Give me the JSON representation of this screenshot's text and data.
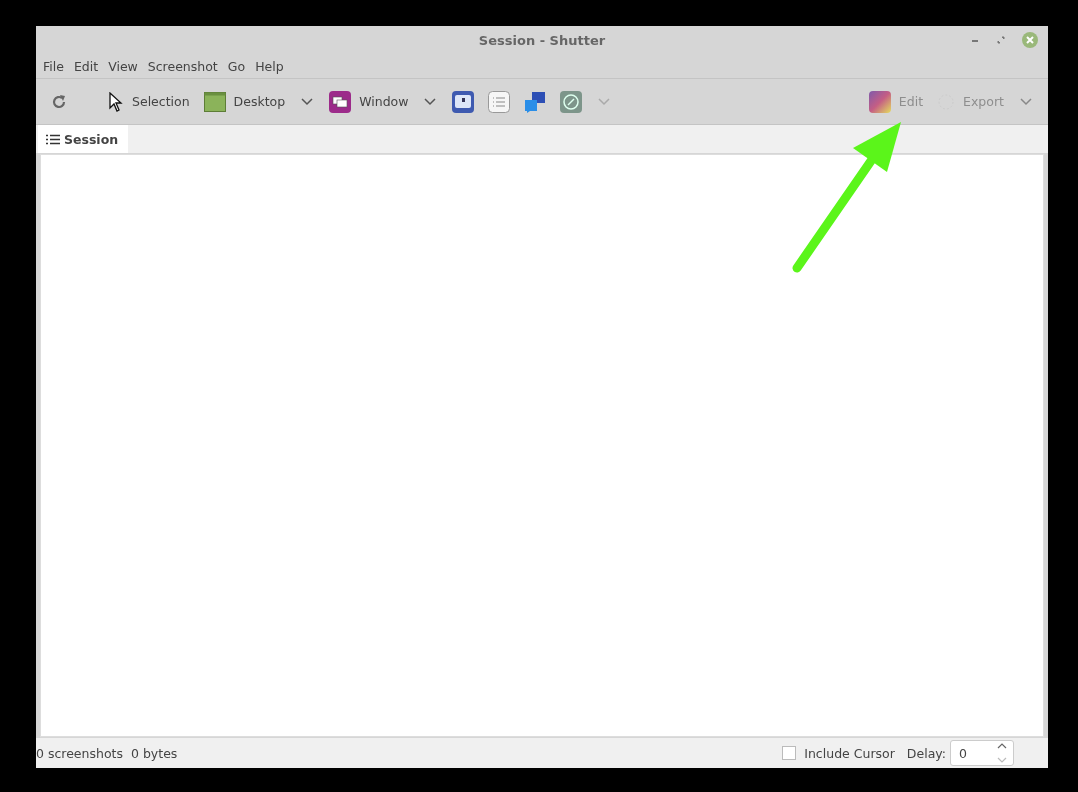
{
  "window": {
    "title": "Session - Shutter"
  },
  "menu": [
    "File",
    "Edit",
    "View",
    "Screenshot",
    "Go",
    "Help"
  ],
  "toolbar": {
    "left": [
      {
        "kind": "refresh"
      },
      {
        "kind": "selection",
        "label": "Selection",
        "has_menu": false
      },
      {
        "kind": "desktop",
        "label": "Desktop",
        "has_menu": true
      },
      {
        "kind": "window",
        "label": "Window",
        "has_menu": true
      },
      {
        "kind": "menu-capture"
      },
      {
        "kind": "tooltip-capture"
      },
      {
        "kind": "help-capture"
      },
      {
        "kind": "web-capture",
        "has_menu": true
      }
    ],
    "right": [
      {
        "kind": "edit",
        "label": "Edit",
        "disabled": true,
        "has_menu": false
      },
      {
        "kind": "export",
        "label": "Export",
        "disabled": true,
        "has_menu": true
      }
    ]
  },
  "tabs": [
    {
      "label": "Session",
      "selected": true
    }
  ],
  "status": {
    "count": "0 screenshots",
    "size": "0 bytes",
    "include_cursor": {
      "label": "Include Cursor",
      "checked": false
    },
    "delay": {
      "label": "Delay:",
      "value": "0"
    }
  }
}
